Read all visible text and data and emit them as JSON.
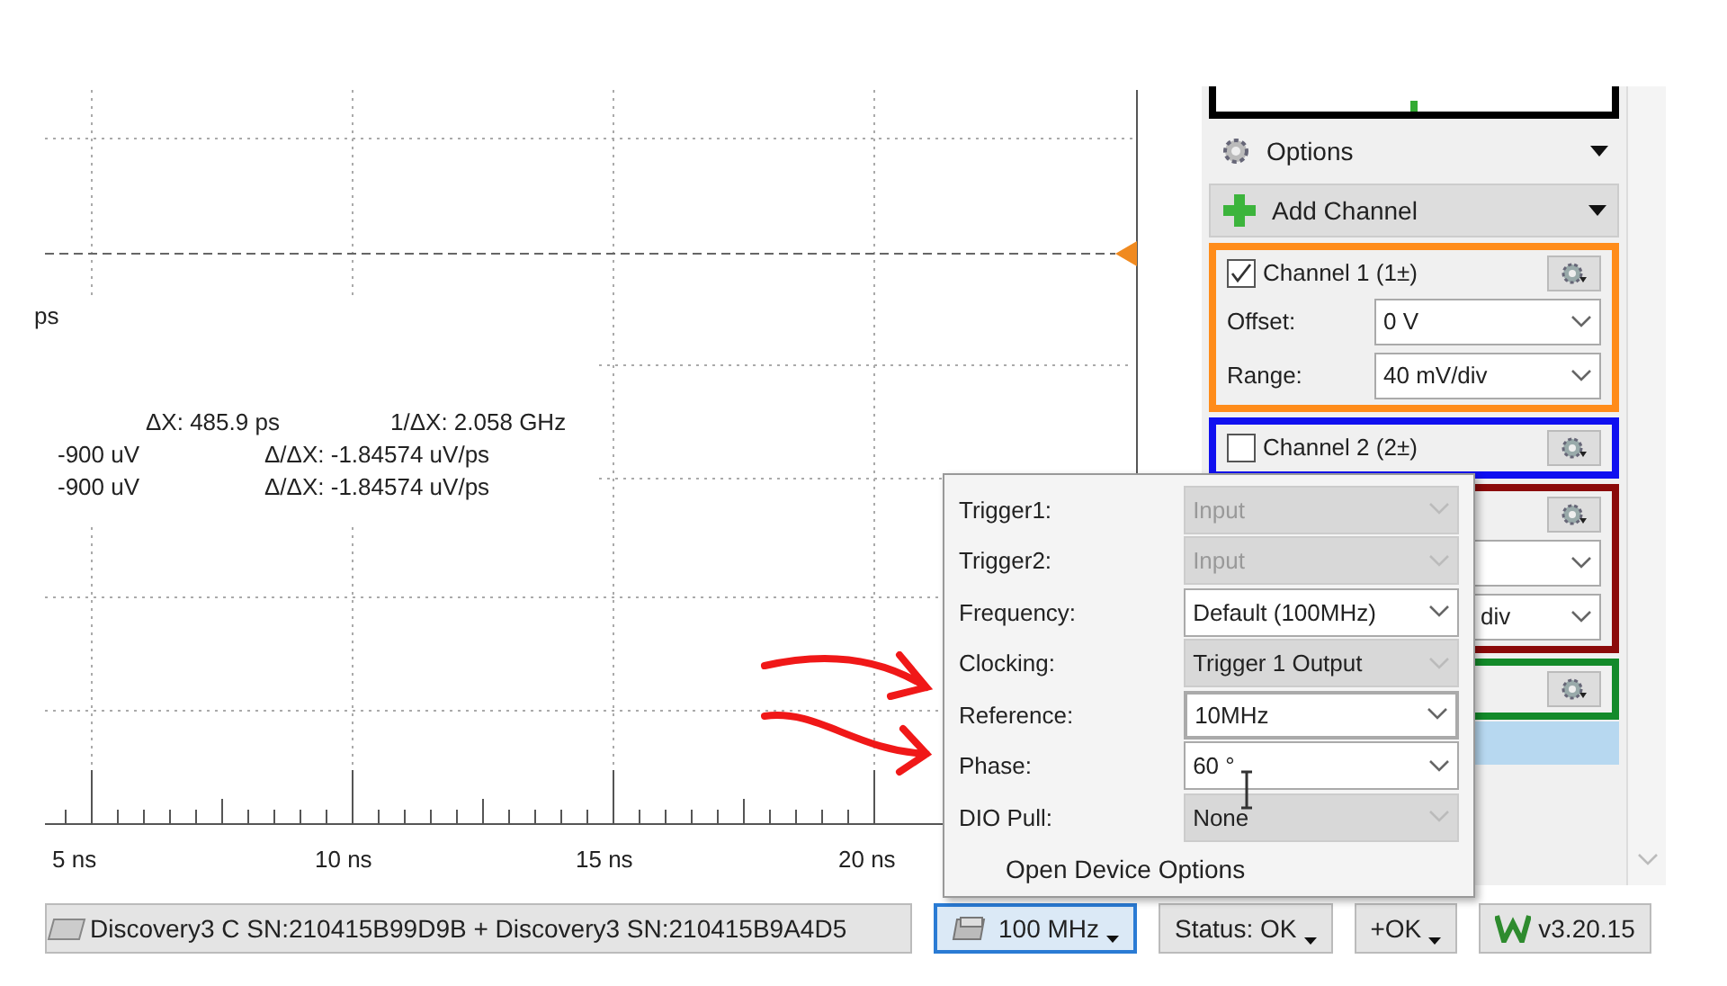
{
  "plot": {
    "cut_label": "ps",
    "measurements": [
      {
        "text": "ΔX: 485.9 ps"
      },
      {
        "text": "1/ΔX: 2.058 GHz"
      }
    ],
    "cursor_rows": [
      {
        "value": "-900 uV",
        "slope": "Δ/ΔX: -1.84574 uV/ps"
      },
      {
        "value": "-900 uV",
        "slope": "Δ/ΔX: -1.84574 uV/ps"
      }
    ],
    "x_labels": [
      "5 ns",
      "10 ns",
      "15 ns",
      "20 ns"
    ]
  },
  "panel": {
    "options": {
      "label": "Options"
    },
    "add_channel": {
      "label": "Add Channel"
    },
    "channels": [
      {
        "name": "Channel 1 (1±)",
        "checked": true,
        "color": "#ff8c1a",
        "fields": [
          {
            "kind": "dropdown",
            "label": "Offset:",
            "value": "0 V"
          },
          {
            "kind": "dropdown",
            "label": "Range:",
            "value": "40 mV/div"
          }
        ]
      },
      {
        "name": "Channel 2 (2±)",
        "checked": false,
        "color": "#1010f0"
      },
      {
        "color": "#8b0a0a",
        "fields": [
          {
            "kind": "dropdown"
          },
          {
            "kind": "dropdown",
            "value": "div"
          }
        ]
      },
      {
        "color": "#138a2a"
      }
    ]
  },
  "popup": {
    "rows": [
      {
        "label": "Trigger1:",
        "value": "Input",
        "disabled": true
      },
      {
        "label": "Trigger2:",
        "value": "Input",
        "disabled": true
      },
      {
        "label": "Frequency:",
        "value": "Default (100MHz)",
        "disabled": false
      },
      {
        "label": "Clocking:",
        "value": "Trigger 1 Output",
        "disabled": true
      },
      {
        "label": "Reference:",
        "value": "10MHz",
        "disabled": false,
        "focused": true
      },
      {
        "label": "Phase:",
        "value": "60 °",
        "disabled": false
      },
      {
        "label": "DIO Pull:",
        "value": "None",
        "disabled": true
      }
    ],
    "link": "Open Device Options"
  },
  "status_bar": {
    "device": "Discovery3 C SN:210415B99D9B + Discovery3 SN:210415B9A4D5",
    "items": [
      {
        "label": "100 MHz",
        "selected": true
      },
      {
        "label": "Status: OK",
        "selected": false
      },
      {
        "label": "+OK",
        "selected": false
      },
      {
        "label": "v3.20.15",
        "selected": false
      }
    ]
  }
}
